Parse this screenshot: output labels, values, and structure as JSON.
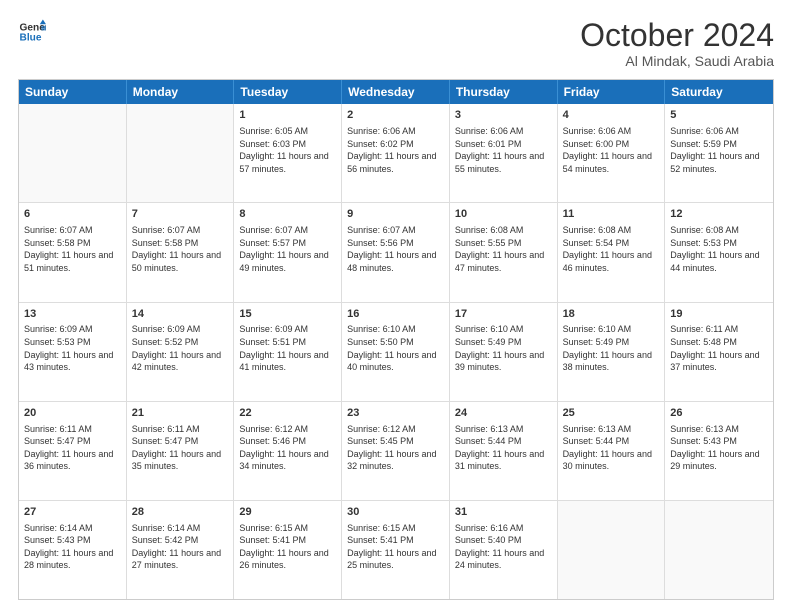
{
  "logo": {
    "line1": "General",
    "line2": "Blue"
  },
  "title": "October 2024",
  "subtitle": "Al Mindak, Saudi Arabia",
  "header_days": [
    "Sunday",
    "Monday",
    "Tuesday",
    "Wednesday",
    "Thursday",
    "Friday",
    "Saturday"
  ],
  "weeks": [
    [
      {
        "day": "",
        "info": ""
      },
      {
        "day": "",
        "info": ""
      },
      {
        "day": "1",
        "info": "Sunrise: 6:05 AM\nSunset: 6:03 PM\nDaylight: 11 hours and 57 minutes."
      },
      {
        "day": "2",
        "info": "Sunrise: 6:06 AM\nSunset: 6:02 PM\nDaylight: 11 hours and 56 minutes."
      },
      {
        "day": "3",
        "info": "Sunrise: 6:06 AM\nSunset: 6:01 PM\nDaylight: 11 hours and 55 minutes."
      },
      {
        "day": "4",
        "info": "Sunrise: 6:06 AM\nSunset: 6:00 PM\nDaylight: 11 hours and 54 minutes."
      },
      {
        "day": "5",
        "info": "Sunrise: 6:06 AM\nSunset: 5:59 PM\nDaylight: 11 hours and 52 minutes."
      }
    ],
    [
      {
        "day": "6",
        "info": "Sunrise: 6:07 AM\nSunset: 5:58 PM\nDaylight: 11 hours and 51 minutes."
      },
      {
        "day": "7",
        "info": "Sunrise: 6:07 AM\nSunset: 5:58 PM\nDaylight: 11 hours and 50 minutes."
      },
      {
        "day": "8",
        "info": "Sunrise: 6:07 AM\nSunset: 5:57 PM\nDaylight: 11 hours and 49 minutes."
      },
      {
        "day": "9",
        "info": "Sunrise: 6:07 AM\nSunset: 5:56 PM\nDaylight: 11 hours and 48 minutes."
      },
      {
        "day": "10",
        "info": "Sunrise: 6:08 AM\nSunset: 5:55 PM\nDaylight: 11 hours and 47 minutes."
      },
      {
        "day": "11",
        "info": "Sunrise: 6:08 AM\nSunset: 5:54 PM\nDaylight: 11 hours and 46 minutes."
      },
      {
        "day": "12",
        "info": "Sunrise: 6:08 AM\nSunset: 5:53 PM\nDaylight: 11 hours and 44 minutes."
      }
    ],
    [
      {
        "day": "13",
        "info": "Sunrise: 6:09 AM\nSunset: 5:53 PM\nDaylight: 11 hours and 43 minutes."
      },
      {
        "day": "14",
        "info": "Sunrise: 6:09 AM\nSunset: 5:52 PM\nDaylight: 11 hours and 42 minutes."
      },
      {
        "day": "15",
        "info": "Sunrise: 6:09 AM\nSunset: 5:51 PM\nDaylight: 11 hours and 41 minutes."
      },
      {
        "day": "16",
        "info": "Sunrise: 6:10 AM\nSunset: 5:50 PM\nDaylight: 11 hours and 40 minutes."
      },
      {
        "day": "17",
        "info": "Sunrise: 6:10 AM\nSunset: 5:49 PM\nDaylight: 11 hours and 39 minutes."
      },
      {
        "day": "18",
        "info": "Sunrise: 6:10 AM\nSunset: 5:49 PM\nDaylight: 11 hours and 38 minutes."
      },
      {
        "day": "19",
        "info": "Sunrise: 6:11 AM\nSunset: 5:48 PM\nDaylight: 11 hours and 37 minutes."
      }
    ],
    [
      {
        "day": "20",
        "info": "Sunrise: 6:11 AM\nSunset: 5:47 PM\nDaylight: 11 hours and 36 minutes."
      },
      {
        "day": "21",
        "info": "Sunrise: 6:11 AM\nSunset: 5:47 PM\nDaylight: 11 hours and 35 minutes."
      },
      {
        "day": "22",
        "info": "Sunrise: 6:12 AM\nSunset: 5:46 PM\nDaylight: 11 hours and 34 minutes."
      },
      {
        "day": "23",
        "info": "Sunrise: 6:12 AM\nSunset: 5:45 PM\nDaylight: 11 hours and 32 minutes."
      },
      {
        "day": "24",
        "info": "Sunrise: 6:13 AM\nSunset: 5:44 PM\nDaylight: 11 hours and 31 minutes."
      },
      {
        "day": "25",
        "info": "Sunrise: 6:13 AM\nSunset: 5:44 PM\nDaylight: 11 hours and 30 minutes."
      },
      {
        "day": "26",
        "info": "Sunrise: 6:13 AM\nSunset: 5:43 PM\nDaylight: 11 hours and 29 minutes."
      }
    ],
    [
      {
        "day": "27",
        "info": "Sunrise: 6:14 AM\nSunset: 5:43 PM\nDaylight: 11 hours and 28 minutes."
      },
      {
        "day": "28",
        "info": "Sunrise: 6:14 AM\nSunset: 5:42 PM\nDaylight: 11 hours and 27 minutes."
      },
      {
        "day": "29",
        "info": "Sunrise: 6:15 AM\nSunset: 5:41 PM\nDaylight: 11 hours and 26 minutes."
      },
      {
        "day": "30",
        "info": "Sunrise: 6:15 AM\nSunset: 5:41 PM\nDaylight: 11 hours and 25 minutes."
      },
      {
        "day": "31",
        "info": "Sunrise: 6:16 AM\nSunset: 5:40 PM\nDaylight: 11 hours and 24 minutes."
      },
      {
        "day": "",
        "info": ""
      },
      {
        "day": "",
        "info": ""
      }
    ]
  ]
}
